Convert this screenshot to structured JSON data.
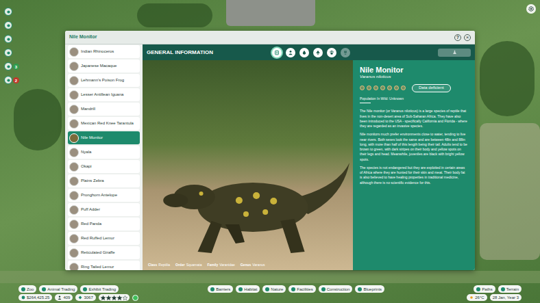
{
  "window": {
    "title": "Nile Monitor",
    "help": "?",
    "close": "×"
  },
  "hud": {
    "badges": [
      {
        "count": "3",
        "color": "#2e9e4f"
      },
      {
        "count": "2",
        "color": "#c0392b"
      }
    ]
  },
  "animal_list": {
    "items": [
      {
        "label": "Indian Rhinoceros",
        "selected": false
      },
      {
        "label": "Japanese Macaque",
        "selected": false
      },
      {
        "label": "Lehmann's Poison Frog",
        "selected": false
      },
      {
        "label": "Lesser Antillean Iguana",
        "selected": false
      },
      {
        "label": "Mandrill",
        "selected": false
      },
      {
        "label": "Mexican Red Knee Tarantula",
        "selected": false
      },
      {
        "label": "Nile Monitor",
        "selected": true
      },
      {
        "label": "Nyala",
        "selected": false
      },
      {
        "label": "Okapi",
        "selected": false
      },
      {
        "label": "Plains Zebra",
        "selected": false
      },
      {
        "label": "Pronghorn Antelope",
        "selected": false
      },
      {
        "label": "Puff Adder",
        "selected": false
      },
      {
        "label": "Red Panda",
        "selected": false
      },
      {
        "label": "Red Ruffed Lemur",
        "selected": false
      },
      {
        "label": "Reticulated Giraffe",
        "selected": false
      },
      {
        "label": "Ring Tailed Lemur",
        "selected": false
      }
    ]
  },
  "section": {
    "title": "GENERAL INFORMATION",
    "tabs": [
      {
        "kind": "book",
        "selected": true,
        "disabled": false
      },
      {
        "kind": "keeper",
        "selected": false,
        "disabled": false
      },
      {
        "kind": "water",
        "selected": false,
        "disabled": false
      },
      {
        "kind": "habitat",
        "selected": false,
        "disabled": false
      },
      {
        "kind": "paw",
        "selected": false,
        "disabled": false
      },
      {
        "kind": "trophy",
        "selected": false,
        "disabled": true
      }
    ],
    "research_button": {
      "disabled": true
    }
  },
  "taxonomy": [
    {
      "label": "Class",
      "value": "Reptilia"
    },
    {
      "label": "Order",
      "value": "Squamata"
    },
    {
      "label": "Family",
      "value": "Varanidae"
    },
    {
      "label": "Genus",
      "value": "Varanus"
    }
  ],
  "info": {
    "name": "Nile Monitor",
    "latin": "Varanus niloticus",
    "conservation_scale": [
      {
        "selected": false
      },
      {
        "selected": false
      },
      {
        "selected": false
      },
      {
        "selected": false
      },
      {
        "selected": false
      },
      {
        "selected": false
      },
      {
        "selected": false
      }
    ],
    "status": "Data deficient",
    "population": "Population In Wild: Unknown",
    "paragraphs": [
      "The Nile monitor (or Varanus niloticus) is a large species of reptile that lives in the non-desert area of Sub-Saharan Africa. They have also been introduced to the USA - specifically California and Florida - where they are regarded as an invasive species.",
      "Nile monitors much prefer environments close to water, tending to live near rivers. Both sexes look the same and are between 48in and 88in long, with more than half of this length being their tail. Adults tend to be brown to green, with dark stripes on their body and yellow spots on their legs and head. Meanwhile, juveniles are black with bright yellow spots.",
      "The species is not endangered but they are exploited in certain areas of Africa where they are hunted for their skin and meat. Their body fat is also believed to have healing properties in traditional medicine, although there is no scientific evidence for this."
    ]
  },
  "bottom_bar": {
    "left_buttons": [
      "Zoo",
      "Animal Trading",
      "Exhibit Trading"
    ],
    "center_buttons": [
      "Barriers",
      "Habitat",
      "Nature",
      "Facilities",
      "Construction",
      "Blueprints"
    ],
    "right_buttons": [
      "Paths",
      "Terrain"
    ]
  },
  "status_bar": {
    "money": "$264,425.25",
    "guests": "409",
    "conservation_credits": "3067",
    "stars": 4,
    "temperature": "26°C",
    "date": "28 Jan, Year 3"
  }
}
